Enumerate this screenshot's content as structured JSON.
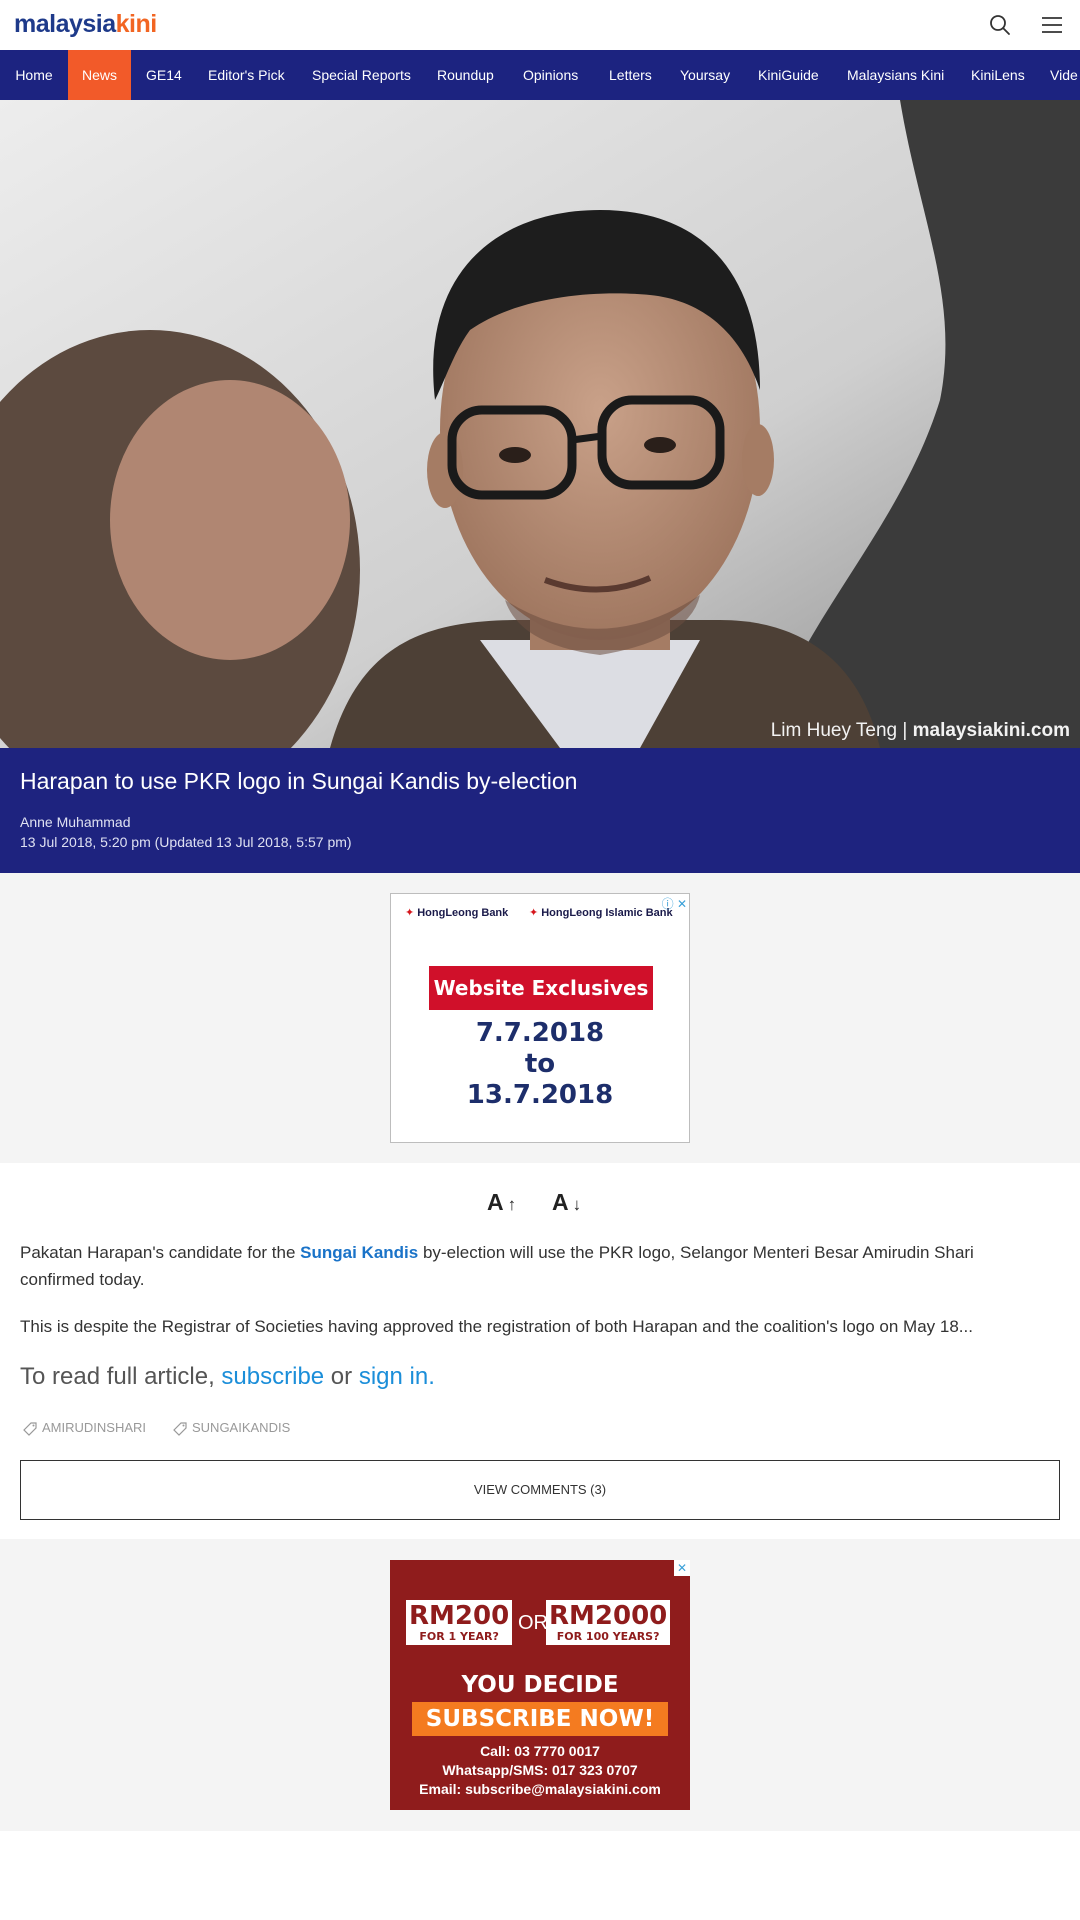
{
  "header": {
    "logo_part1": "malaysia",
    "logo_part2": "kini",
    "icons": [
      "search-icon",
      "hamburger-menu-icon"
    ]
  },
  "nav": {
    "items": [
      {
        "label": "Home",
        "active": false
      },
      {
        "label": "News",
        "active": true
      },
      {
        "label": "GE14",
        "active": false
      },
      {
        "label": "Editor's Pick",
        "active": false
      },
      {
        "label": "Special Reports",
        "active": false
      },
      {
        "label": "Roundup",
        "active": false
      },
      {
        "label": "Opinions",
        "active": false
      },
      {
        "label": "Letters",
        "active": false
      },
      {
        "label": "Yoursay",
        "active": false
      },
      {
        "label": "KiniGuide",
        "active": false
      },
      {
        "label": "Malaysians Kini",
        "active": false
      },
      {
        "label": "KiniLens",
        "active": false
      },
      {
        "label": "Vide",
        "active": false
      }
    ]
  },
  "hero": {
    "credit_name": "Lim Huey Teng |",
    "credit_site": "malaysiakini.com"
  },
  "article": {
    "title": "Harapan to use PKR logo in Sungai Kandis by-election",
    "author": "Anne Muhammad",
    "date": "13 Jul 2018, 5:20 pm (Updated 13 Jul 2018, 5:57 pm)",
    "font_increase": "A",
    "font_decrease": "A",
    "para1_before": "Pakatan Harapan's candidate for the ",
    "para1_link": "Sungai Kandis",
    "para1_after": " by-election will use the PKR logo, Selangor Menteri Besar Amirudin Shari confirmed today.",
    "para2": "This is despite the Registrar of Societies having approved the registration of both Harapan and the coalition's logo on May 18...",
    "readmore_prefix": "To read full article, ",
    "subscribe_link": "subscribe",
    "or_text": " or ",
    "signin_link": "sign in.",
    "tags": [
      "AMIRUDINSHARI",
      "SUNGAIKANDIS"
    ],
    "comments_button": "VIEW COMMENTS (3)"
  },
  "ad1": {
    "bank1": "HongLeong Bank",
    "bank2": "HongLeong Islamic Bank",
    "headline": "Website Exclusives",
    "date_from": "7.7.2018",
    "date_to_word": "to",
    "date_to": "13.7.2018"
  },
  "ad2": {
    "price1": "RM200",
    "price1_sub": "FOR 1 YEAR?",
    "or": "OR",
    "price2": "RM2000",
    "price2_sub": "FOR 100 YEARS?",
    "decide": "YOU DECIDE",
    "cta": "SUBSCRIBE NOW!",
    "call": "Call: 03 7770 0017",
    "whatsapp": "Whatsapp/SMS: 017 323 0707",
    "email": "Email: subscribe@malaysiakini.com"
  },
  "colors": {
    "brand_navy": "#1c2380",
    "brand_orange": "#f25a29",
    "link_blue": "#1a73c8"
  }
}
